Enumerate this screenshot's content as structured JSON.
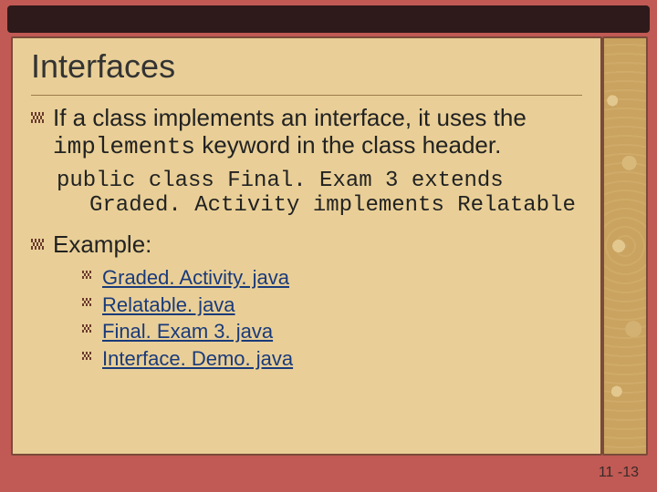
{
  "title": "Interfaces",
  "body": {
    "point1": {
      "prefix": "If a class implements an interface, it uses the ",
      "keyword": "implements",
      "suffix": " keyword in the class header."
    },
    "code": {
      "line1": "public class Final. Exam 3 extends",
      "line2": "Graded. Activity implements Relatable"
    },
    "example_label": "Example:",
    "links": [
      "Graded. Activity. java",
      "Relatable. java",
      "Final. Exam 3. java",
      "Interface. Demo. java"
    ]
  },
  "page_number": "11 -13"
}
